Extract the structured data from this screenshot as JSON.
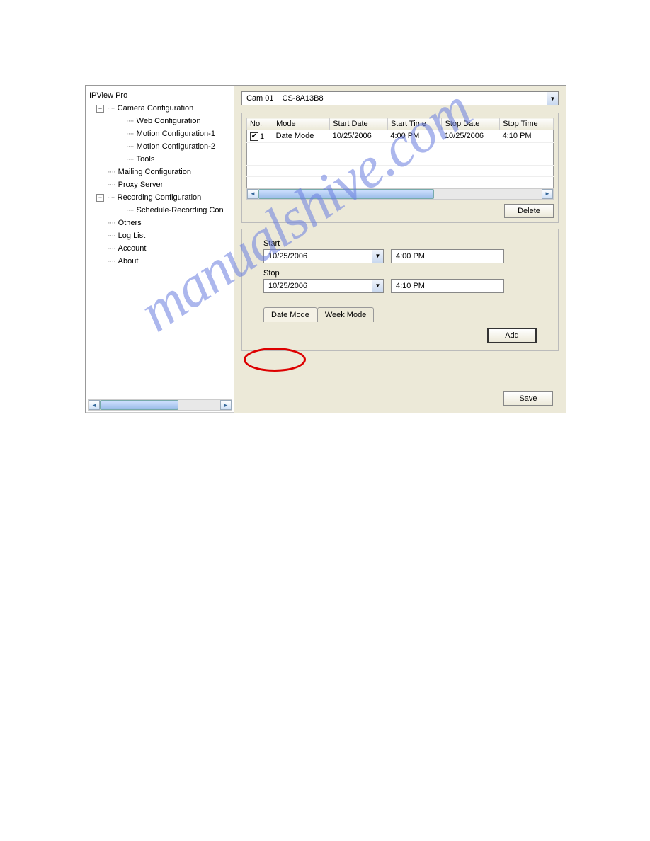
{
  "tree": {
    "root": "IPView Pro",
    "camera_config": "Camera Configuration",
    "web_config": "Web Configuration",
    "motion1": "Motion Configuration-1",
    "motion2": "Motion Configuration-2",
    "tools": "Tools",
    "mailing": "Mailing Configuration",
    "proxy": "Proxy Server",
    "recording": "Recording Configuration",
    "schedule": "Schedule-Recording Con",
    "others": "Others",
    "loglist": "Log List",
    "account": "Account",
    "about": "About"
  },
  "camera_select": {
    "cam_no": "Cam 01",
    "cam_name": "CS-8A13B8"
  },
  "table": {
    "headers": {
      "no": "No.",
      "mode": "Mode",
      "start_date": "Start Date",
      "start_time": "Start Time",
      "stop_date": "Stop Date",
      "stop_time": "Stop Time"
    },
    "rows": [
      {
        "no": "1",
        "mode": "Date Mode",
        "start_date": "10/25/2006",
        "start_time": "4:00 PM",
        "stop_date": "10/25/2006",
        "stop_time": "4:10 PM"
      }
    ]
  },
  "buttons": {
    "delete": "Delete",
    "add": "Add",
    "save": "Save"
  },
  "schedule_edit": {
    "start_label": "Start",
    "stop_label": "Stop",
    "start_date": "10/25/2006",
    "start_time": "4:00 PM",
    "stop_date": "10/25/2006",
    "stop_time": "4:10 PM"
  },
  "tabs": {
    "date_mode": "Date Mode",
    "week_mode": "Week Mode"
  },
  "watermark": "manualshive.com",
  "expander_minus": "−"
}
